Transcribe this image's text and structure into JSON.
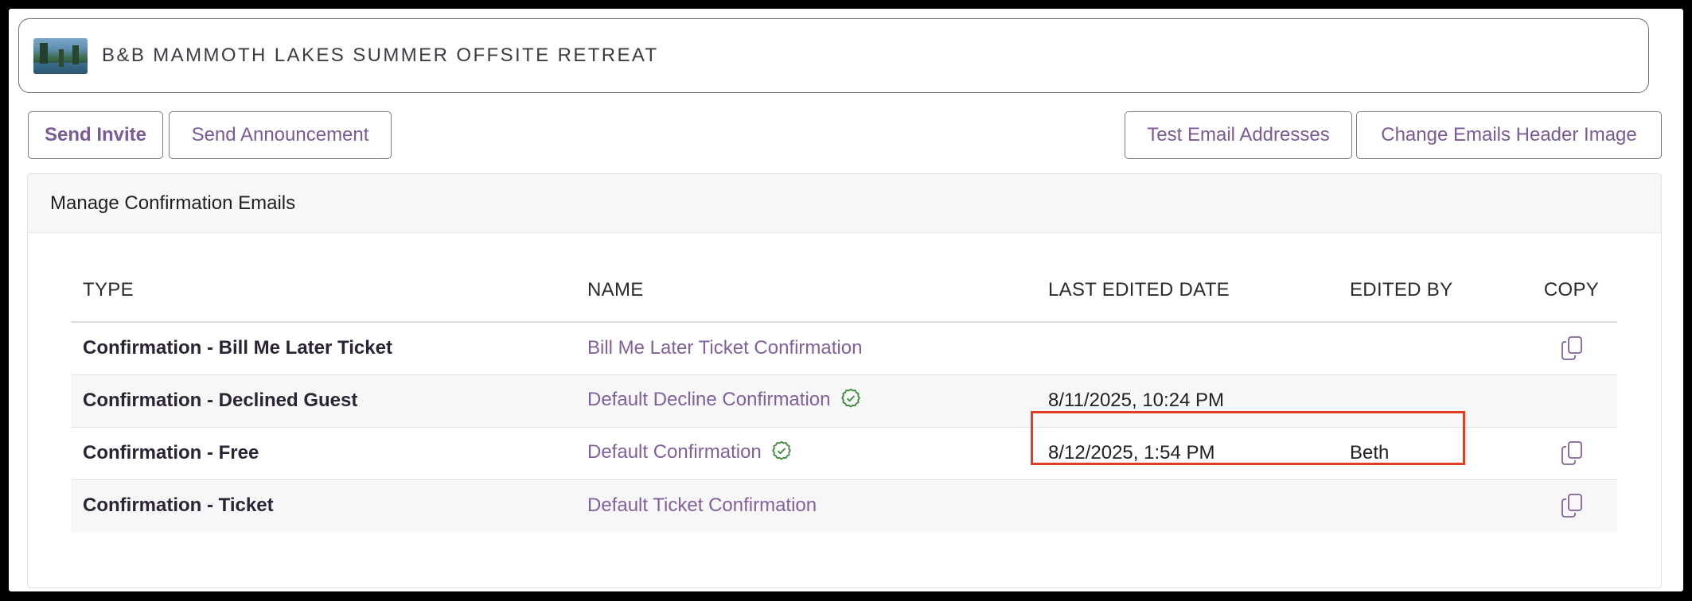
{
  "event": {
    "title": "B&B MAMMOTH LAKES SUMMER OFFSITE RETREAT"
  },
  "toolbar": {
    "send_invite": "Send Invite",
    "send_announcement": "Send Announcement",
    "test_email": "Test Email Addresses",
    "change_header": "Change Emails Header Image"
  },
  "panel": {
    "title": "Manage Confirmation Emails"
  },
  "table": {
    "headers": {
      "type": "TYPE",
      "name": "NAME",
      "date": "LAST EDITED DATE",
      "by": "EDITED BY",
      "copy": "COPY"
    },
    "rows": [
      {
        "type": "Confirmation - Bill Me Later Ticket",
        "name": "Bill Me Later Ticket Confirmation",
        "date": "",
        "by": ""
      },
      {
        "type": "Confirmation - Declined Guest",
        "name": "Default Decline Confirmation",
        "date": "8/11/2025, 10:24 PM",
        "by": ""
      },
      {
        "type": "Confirmation - Free",
        "name": "Default Confirmation",
        "date": "8/12/2025, 1:54 PM",
        "by": "Beth"
      },
      {
        "type": "Confirmation - Ticket",
        "name": "Default Ticket Confirmation",
        "date": "",
        "by": ""
      }
    ]
  },
  "icons": {
    "check": "check-circle-icon",
    "copy": "copy-icon"
  },
  "colors": {
    "accent": "#80609d",
    "check": "#3a8a3a",
    "highlight": "#e23e22"
  }
}
